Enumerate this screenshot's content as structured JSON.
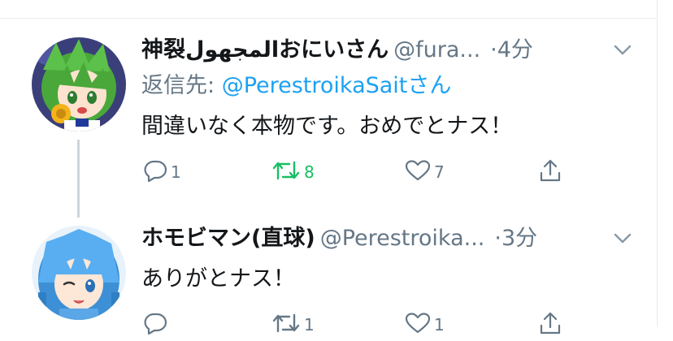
{
  "colors": {
    "text": "#14171a",
    "secondary": "#657786",
    "link": "#1da1f2",
    "retweet_active": "#17bf63",
    "divider": "#e6ecf0",
    "thread_line": "#ccd6dd"
  },
  "tweets": [
    {
      "display_name": "神裂المجهولおにいさん",
      "handle": "@fura...",
      "separator": "·",
      "time": "4分",
      "reply_to_prefix": "返信先: ",
      "reply_to_mention": "@PerestroikaSaitさん",
      "text": "間違いなく本物です。おめでとナス！",
      "actions": {
        "reply_count": "1",
        "retweet_count": "8",
        "retweet_active": true,
        "like_count": "7"
      },
      "icons": [
        "reply-icon",
        "retweet-icon",
        "like-icon",
        "share-icon",
        "chevron-down-icon"
      ]
    },
    {
      "display_name": "ホモビマン(直球)",
      "handle": "@Perestroika...",
      "separator": "·",
      "time": "3分",
      "text": "ありがとナス！",
      "actions": {
        "reply_count": "",
        "retweet_count": "1",
        "retweet_active": false,
        "like_count": "1"
      },
      "icons": [
        "reply-icon",
        "retweet-icon",
        "like-icon",
        "share-icon",
        "chevron-down-icon"
      ]
    }
  ]
}
